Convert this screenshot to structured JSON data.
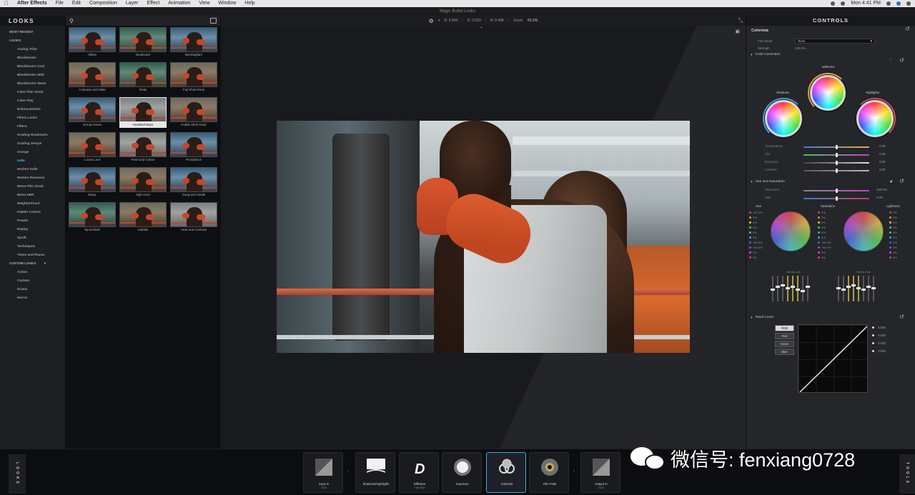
{
  "menubar": {
    "app_name": "After Effects",
    "items": [
      "File",
      "Edit",
      "Composition",
      "Layer",
      "Effect",
      "Animation",
      "View",
      "Window",
      "Help"
    ],
    "clock": "Mon 4:41 PM"
  },
  "window": {
    "title": "Magic Bullet Looks"
  },
  "looks_panel": {
    "header": "LOOKS",
    "items": [
      {
        "label": "MOST RECENT",
        "kind": "section"
      },
      {
        "label": "LOOKS",
        "kind": "section"
      },
      {
        "label": "Analog Tribe",
        "kind": "sub"
      },
      {
        "label": "Blockbuster",
        "kind": "sub"
      },
      {
        "label": "Blockbuster Cool",
        "kind": "sub"
      },
      {
        "label": "Blockbuster HDR",
        "kind": "sub"
      },
      {
        "label": "Blockbuster Warm",
        "kind": "sub"
      },
      {
        "label": "Color Film Stock",
        "kind": "sub"
      },
      {
        "label": "Color Play",
        "kind": "sub"
      },
      {
        "label": "Enhancements",
        "kind": "sub"
      },
      {
        "label": "Filmic Looks",
        "kind": "sub"
      },
      {
        "label": "Filters",
        "kind": "sub"
      },
      {
        "label": "Grading Headstarts",
        "kind": "sub"
      },
      {
        "label": "Grading Setups",
        "kind": "sub"
      },
      {
        "label": "Grunge",
        "kind": "sub"
      },
      {
        "label": "Indie",
        "kind": "sub",
        "active": true
      },
      {
        "label": "Modern Indie",
        "kind": "sub"
      },
      {
        "label": "Modern Romance",
        "kind": "sub"
      },
      {
        "label": "Mono Film Stock",
        "kind": "sub"
      },
      {
        "label": "Mono HDR",
        "kind": "sub"
      },
      {
        "label": "Neighborhood",
        "kind": "sub"
      },
      {
        "label": "Palette Control",
        "kind": "sub"
      },
      {
        "label": "People",
        "kind": "sub"
      },
      {
        "label": "Replay",
        "kind": "sub"
      },
      {
        "label": "Spoilt",
        "kind": "sub"
      },
      {
        "label": "Techniques",
        "kind": "sub"
      },
      {
        "label": "Times and Places",
        "kind": "sub"
      },
      {
        "label": "CUSTOM LOOKS",
        "kind": "section"
      },
      {
        "label": "Action",
        "kind": "sub"
      },
      {
        "label": "Custom",
        "kind": "sub"
      },
      {
        "label": "Drama",
        "kind": "sub"
      },
      {
        "label": "Horror",
        "kind": "sub"
      }
    ]
  },
  "thumbnails": [
    {
      "label": "Abbey",
      "tone": "cool"
    },
    {
      "label": "Boulevard",
      "tone": "green"
    },
    {
      "label": "Buckingham",
      "tone": "cool"
    },
    {
      "label": "Colorado and Slate",
      "tone": "warm"
    },
    {
      "label": "Delia",
      "tone": "green"
    },
    {
      "label": "Fuji Short Ends",
      "tone": "warm"
    },
    {
      "label": "Group House",
      "tone": "cool"
    },
    {
      "label": "Hundred Days",
      "tone": "faded",
      "selected": true
    },
    {
      "label": "Kodak Short Ends",
      "tone": "warm"
    },
    {
      "label": "Loose Leaf",
      "tone": "warm"
    },
    {
      "label": "Pearl and Cotton",
      "tone": "faded"
    },
    {
      "label": "Providence",
      "tone": "cool"
    },
    {
      "label": "Ratsy",
      "tone": "cool"
    },
    {
      "label": "Sigh Anon",
      "tone": "warm"
    },
    {
      "label": "Song and Castle",
      "tone": "cool"
    },
    {
      "label": "Spoonfolds",
      "tone": "green"
    },
    {
      "label": "Subtitle",
      "tone": "warm"
    },
    {
      "label": "Vesk and Contrast",
      "tone": "faded"
    }
  ],
  "viewer": {
    "readout_r": "R: 0.494",
    "readout_g": "G: 0.529",
    "readout_b": "B: 0.498",
    "zoom_label": "Zoom:",
    "zoom_value": "81.5%"
  },
  "controls": {
    "header": "CONTROLS",
    "tool_name": "Colorista",
    "fast_mode_label": "Fast Mode",
    "fast_mode_value": "None",
    "strength_label": "Strength",
    "strength_value": "100.0%",
    "color_correction": "Color Correction",
    "shadows": "Shadows",
    "midtones": "Midtones",
    "highlights": "Highlights",
    "sliders": [
      {
        "label": "Temperature",
        "value": "0.00"
      },
      {
        "label": "Tint",
        "value": "0.00"
      },
      {
        "label": "Exposure",
        "value": "0.00"
      },
      {
        "label": "Contrast",
        "value": "0.00"
      }
    ],
    "hue_sat": "Hue and Saturation",
    "hs_sliders": [
      {
        "label": "Saturation",
        "value": "100.0%"
      },
      {
        "label": "Vibe",
        "value": "0.00"
      }
    ],
    "hue_label": "Hue",
    "saturation_label": "Saturation",
    "lightness_label": "Lightness",
    "hue_vals": [
      "+87.0%",
      "0%",
      "0%",
      "0%",
      "0%",
      "0%",
      "+80.0%",
      "+60.0%",
      "0%",
      "0%"
    ],
    "sat_vals": [
      "0%",
      "0%",
      "0%",
      "0%",
      "0%",
      "0%",
      "+80.0%",
      "+60.0%",
      "0%",
      "0%"
    ],
    "light_vals": [
      "0%",
      "0%",
      "0%",
      "0%",
      "0%",
      "0%",
      "0%",
      "0%",
      "0%",
      "0%"
    ],
    "sat_by_lum": "Sat by Lum",
    "sat_by_hue": "Sat by Hue",
    "tonal_curve": "Tonal Curve",
    "curve_buttons": [
      "RGB",
      "Red",
      "Green",
      "Blue"
    ],
    "curve_values": [
      "0.000",
      "0.000",
      "0.000",
      "0.000"
    ]
  },
  "tools": [
    {
      "label": "Input In",
      "sub": "2019"
    },
    {
      "label": "Shadows/Highlights",
      "sub": ""
    },
    {
      "label": "Diffusion",
      "sub": "Fast Fine"
    },
    {
      "label": "Exposure",
      "sub": ""
    },
    {
      "label": "Colorista",
      "sub": "",
      "active": true
    },
    {
      "label": "Film Fade",
      "sub": ""
    },
    {
      "label": "Output In",
      "sub": "2019"
    }
  ],
  "side_looks": "LOOKS",
  "side_tools": "TOOLS",
  "watermark": "微信号: fenxiang0728"
}
